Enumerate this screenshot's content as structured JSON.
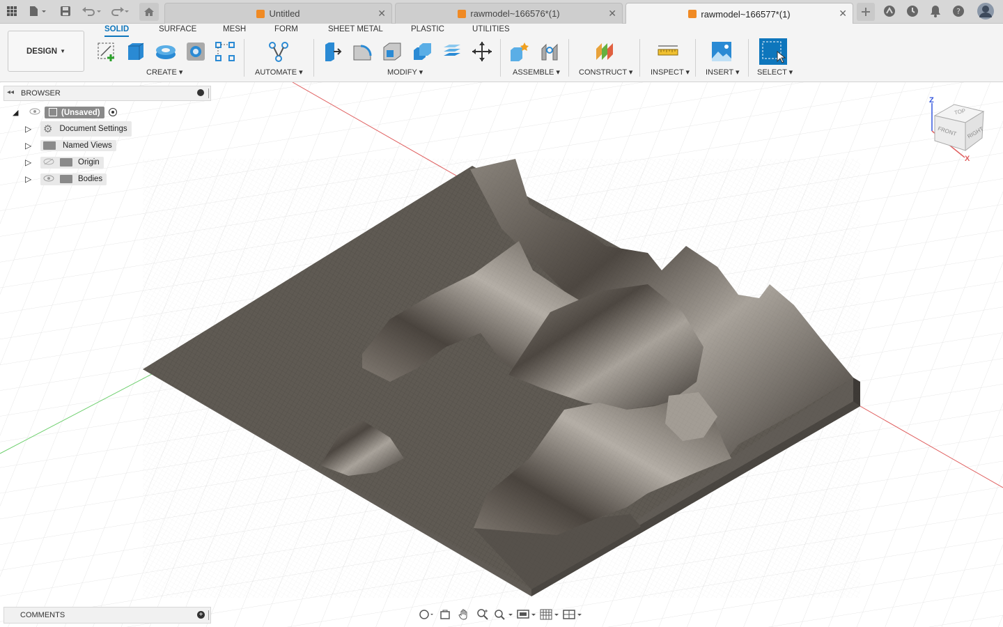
{
  "tabs": [
    {
      "label": "Untitled",
      "active": false
    },
    {
      "label": "rawmodel~166576*(1)",
      "active": false
    },
    {
      "label": "rawmodel~166577*(1)",
      "active": true
    }
  ],
  "workspace": {
    "label": "DESIGN"
  },
  "ribbon_tabs": [
    "SOLID",
    "SURFACE",
    "MESH",
    "FORM",
    "SHEET METAL",
    "PLASTIC",
    "UTILITIES"
  ],
  "ribbon_active": "SOLID",
  "groups": {
    "create": "CREATE",
    "automate": "AUTOMATE",
    "modify": "MODIFY",
    "assemble": "ASSEMBLE",
    "construct": "CONSTRUCT",
    "inspect": "INSPECT",
    "insert": "INSERT",
    "select": "SELECT"
  },
  "browser": {
    "title": "BROWSER",
    "root": "(Unsaved)",
    "items": [
      "Document Settings",
      "Named Views",
      "Origin",
      "Bodies"
    ]
  },
  "comments": {
    "title": "COMMENTS"
  },
  "viewcube": {
    "top": "TOP",
    "front": "FRONT",
    "right": "RIGHT",
    "axis_z": "Z",
    "axis_x": "X"
  },
  "colors": {
    "accent": "#0e76bc",
    "model": "#5f5a53",
    "axis_x": "#e06060",
    "axis_y": "#6fd06f"
  }
}
